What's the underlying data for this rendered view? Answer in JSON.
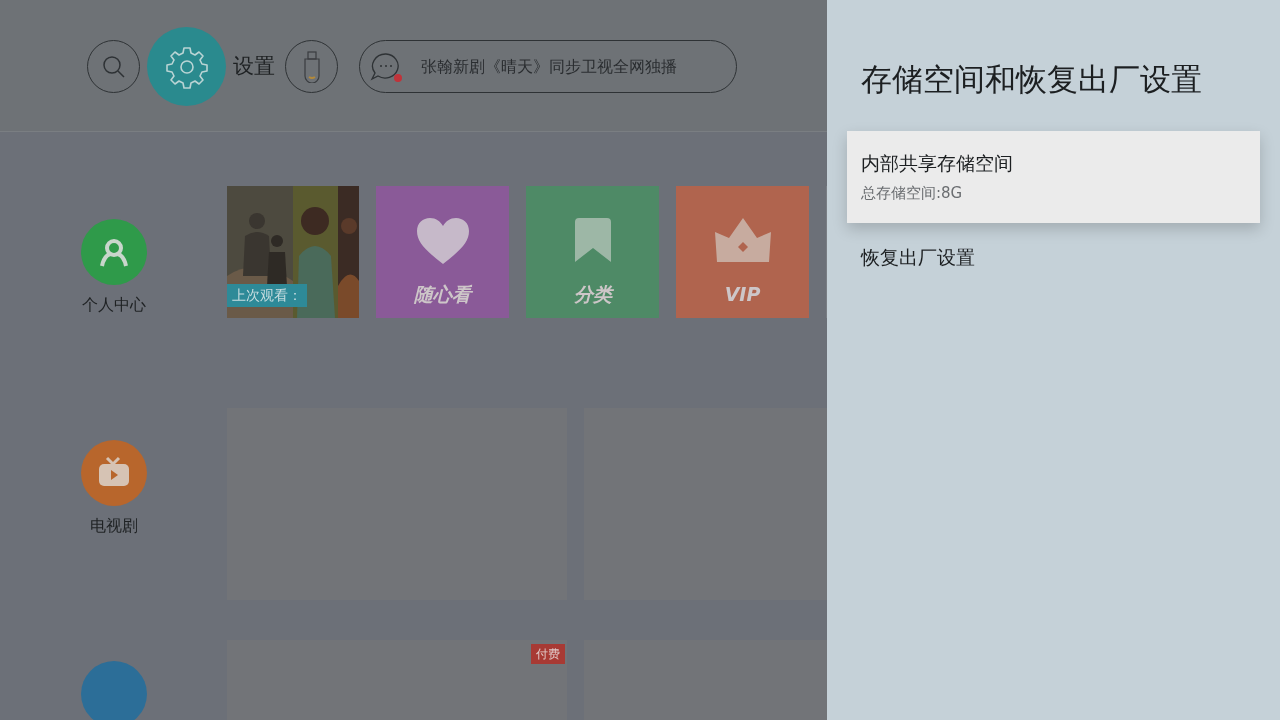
{
  "header": {
    "settings_label": "设置",
    "ticker": "张翰新剧《晴天》同步卫视全网独播"
  },
  "nav": [
    {
      "label": "个人中心",
      "color": "#2f9a4a",
      "kind": "person"
    },
    {
      "label": "电视剧",
      "color": "#b8662c",
      "kind": "tv"
    },
    {
      "color": "#2c6e98",
      "kind": "blank"
    }
  ],
  "tiles": [
    {
      "kind": "poster",
      "label": "上次观看："
    },
    {
      "kind": "heart",
      "label": "随心看",
      "color": "#8a5a98"
    },
    {
      "kind": "bookmark",
      "label": "分类",
      "color": "#4e8a66"
    },
    {
      "kind": "crown",
      "label": "VIP",
      "color": "#b0644e"
    }
  ],
  "cards": [
    {
      "kind": "plain"
    },
    {
      "kind": "plain"
    },
    {
      "kind": "paid",
      "badge": "付费"
    },
    {
      "kind": "plain"
    }
  ],
  "panel": {
    "title": "存储空间和恢复出厂设置",
    "items": [
      {
        "title": "内部共享存储空间",
        "subtitle": "总存储空间:8G",
        "selected": true
      },
      {
        "title": "恢复出厂设置",
        "selected": false
      }
    ]
  }
}
